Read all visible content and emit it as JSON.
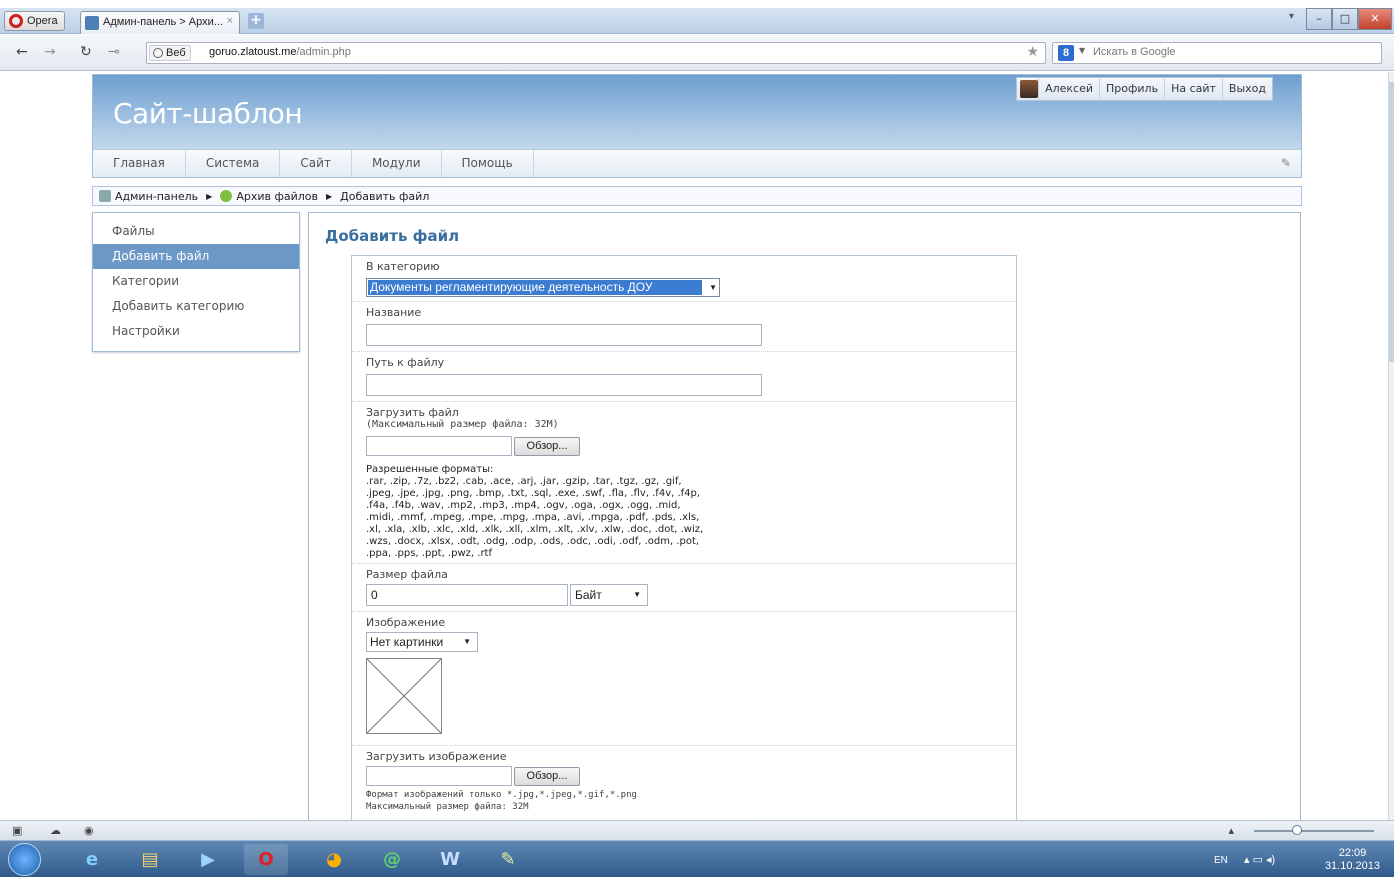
{
  "browser": {
    "app_button": "Opera",
    "tab_title": "Админ-панель > Архи...",
    "tab_close": "×",
    "new_tab": "+",
    "web_badge": "Веб",
    "url_domain": "goruo.zlatoust.me",
    "url_path": "/admin.php",
    "search_placeholder": "Искать в Google",
    "search_engine_glyph": "8"
  },
  "site": {
    "title": "Сайт-шаблон",
    "user": {
      "name": "Алексей",
      "profile": "Профиль",
      "to_site": "На сайт",
      "logout": "Выход"
    },
    "menu": [
      "Главная",
      "Система",
      "Сайт",
      "Модули",
      "Помощь"
    ]
  },
  "breadcrumb": {
    "items": [
      "Админ-панель",
      "Архив файлов",
      "Добавить файл"
    ]
  },
  "sidebar": {
    "items": [
      {
        "label": "Файлы",
        "active": false
      },
      {
        "label": "Добавить файл",
        "active": true
      },
      {
        "label": "Категории",
        "active": false
      },
      {
        "label": "Добавить категорию",
        "active": false
      },
      {
        "label": "Настройки",
        "active": false
      }
    ]
  },
  "content": {
    "title": "Добавить файл"
  },
  "form": {
    "category_label": "В категорию",
    "category_value": "Документы регламентирующие деятельность ДОУ",
    "name_label": "Название",
    "name_value": "",
    "path_label": "Путь к файлу",
    "path_value": "",
    "upload_label": "Загрузить файл",
    "upload_maxsize": "(Максимальный размер файла: 32M)",
    "browse_label": "Обзор...",
    "formats_label": "Разрешенные форматы:",
    "formats_lines": [
      ".rar, .zip, .7z, .bz2, .cab, .ace, .arj, .jar, .gzip, .tar, .tgz, .gz, .gif,",
      ".jpeg, .jpe, .jpg, .png, .bmp, .txt, .sql, .exe, .swf, .fla, .flv, .f4v, .f4p,",
      ".f4a, .f4b, .wav, .mp2, .mp3, .mp4, .ogv, .oga, .ogx, .ogg, .mid,",
      ".midi, .mmf, .mpeg, .mpe, .mpg, .mpa, .avi, .mpga, .pdf, .pds, .xls,",
      ".xl, .xla, .xlb, .xlc, .xld, .xlk, .xll, .xlm, .xlt, .xlv, .xlw, .doc, .dot, .wiz,",
      ".wzs, .docx, .xlsx, .odt, .odg, .odp, .ods, .odc, .odi, .odf, .odm, .pot,",
      ".ppa, .pps, .ppt, .pwz, .rtf"
    ],
    "size_label": "Размер файла",
    "size_value": "0",
    "size_unit": "Байт",
    "image_label": "Изображение",
    "image_value": "Нет картинки",
    "upload_image_label": "Загрузить изображение",
    "image_formats": "Формат изображений только *.jpg,*.jpeg,*.gif,*.png",
    "image_maxsize": "Максимальный размер файла: 32M"
  },
  "taskbar": {
    "lang": "EN",
    "time": "22:09",
    "date": "31.10.2013"
  },
  "colors": {
    "accent": "#6b98c7",
    "title_blue": "#3a6e9e",
    "selection": "#3b7bd0"
  }
}
